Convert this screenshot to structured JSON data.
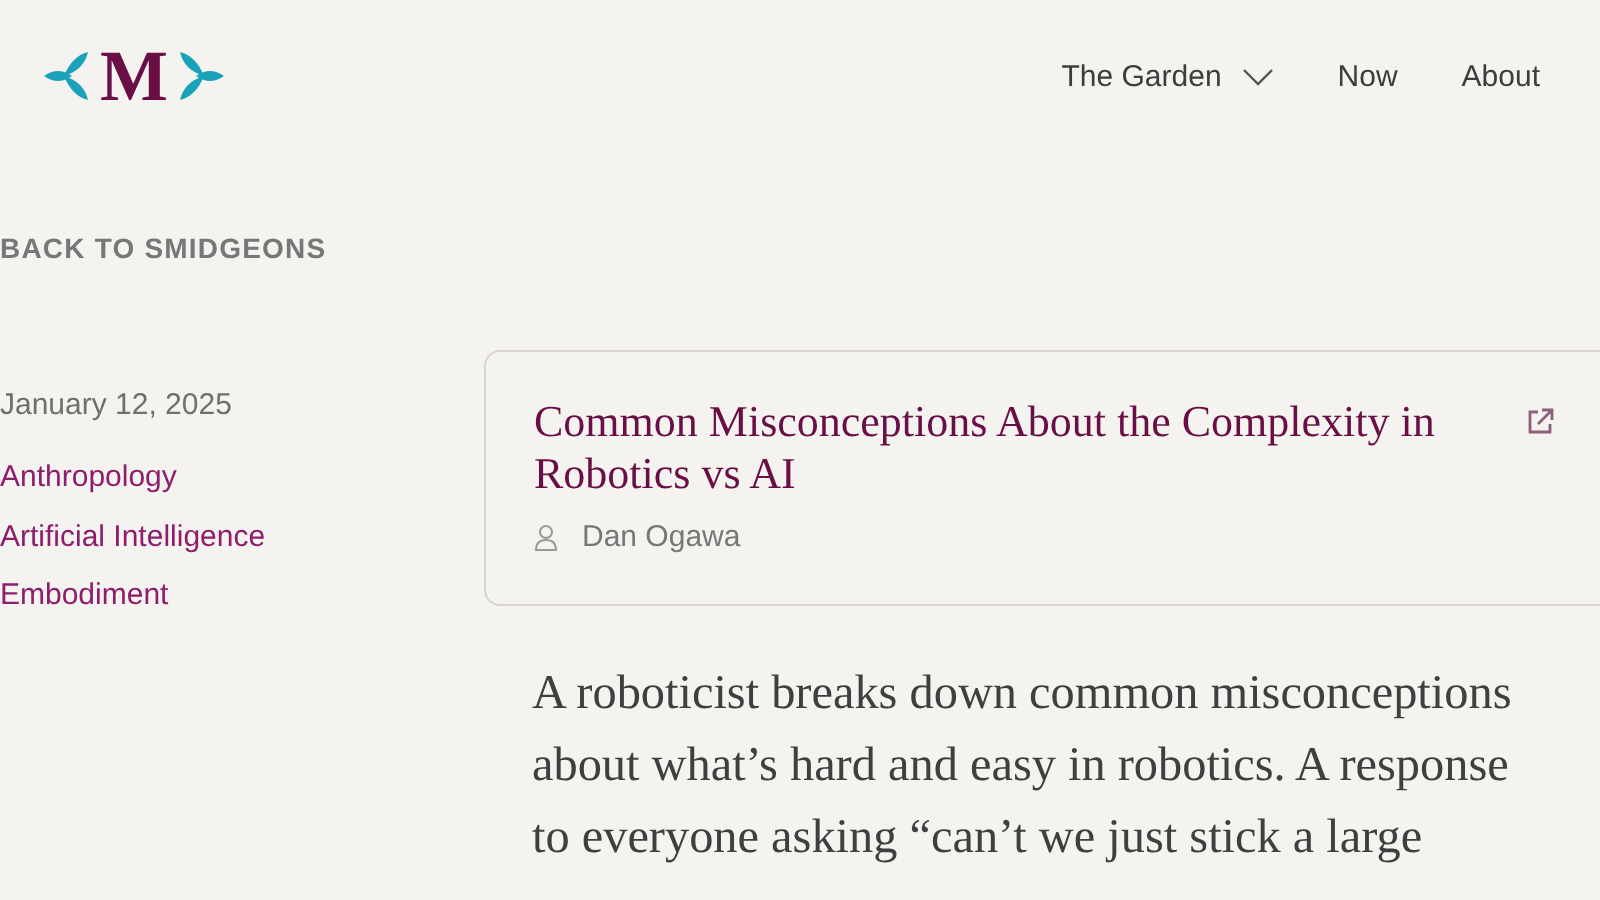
{
  "header": {
    "logo": "M",
    "nav": [
      {
        "label": "The Garden",
        "kind": "dropdown"
      },
      {
        "label": "Now",
        "kind": "link"
      },
      {
        "label": "About",
        "kind": "link"
      }
    ]
  },
  "back_link": "BACK TO SMIDGEONS",
  "sidebar": {
    "date": "January 12, 2025",
    "tags": [
      "Anthropology",
      "Artificial Intelligence",
      "Embodiment"
    ]
  },
  "card": {
    "title": "Common Misconceptions About the Complexity in Robotics vs AI",
    "author": "Dan Ogawa"
  },
  "body": "A roboticist breaks down common misconceptions about what’s hard and easy in robotics. A response to everyone asking “can’t we just stick a large"
}
